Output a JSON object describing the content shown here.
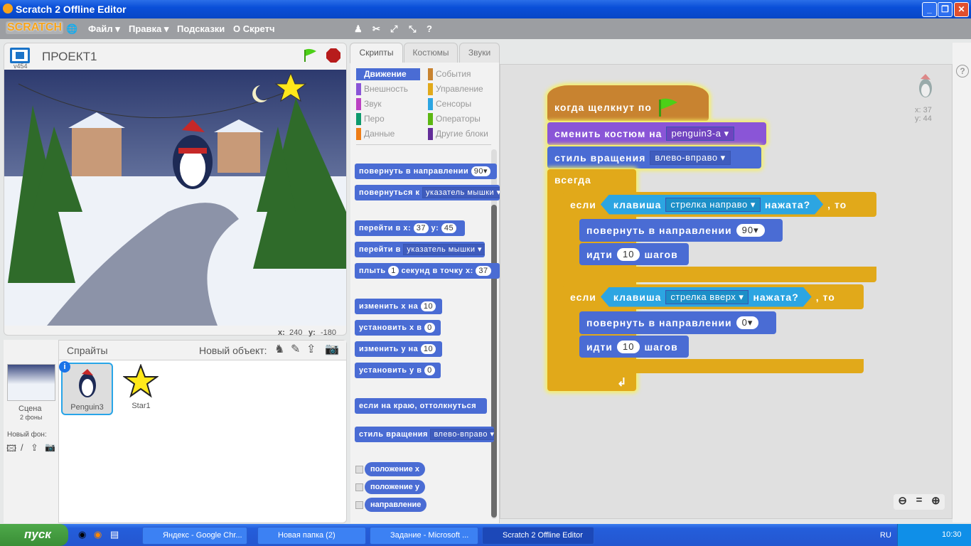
{
  "window": {
    "title": "Scratch 2 Offline Editor"
  },
  "menu": {
    "logo": "SCRATCH",
    "items": [
      "Файл ▾",
      "Правка ▾",
      "Подсказки",
      "О Скретч"
    ]
  },
  "stage": {
    "project_name": "ПРОЕКТ1",
    "version": "v454",
    "x_label": "x:",
    "x_value": "240",
    "y_label": "y:",
    "y_value": "-180"
  },
  "sprites": {
    "header": "Спрайты",
    "new_object": "Новый объект:",
    "stage_label": "Сцена",
    "backdrops": "2 фоны",
    "new_backdrop": "Новый фон:",
    "list": [
      {
        "name": "Penguin3",
        "selected": true
      },
      {
        "name": "Star1",
        "selected": false
      }
    ]
  },
  "tabs": [
    "Скрипты",
    "Костюмы",
    "Звуки"
  ],
  "categories": [
    {
      "label": "Движение",
      "color": "#4a6cd4",
      "active": true
    },
    {
      "label": "События",
      "color": "#c88330"
    },
    {
      "label": "Внешность",
      "color": "#8a55d7"
    },
    {
      "label": "Управление",
      "color": "#e1a91a"
    },
    {
      "label": "Звук",
      "color": "#bb42c3"
    },
    {
      "label": "Сенсоры",
      "color": "#2ca5e2"
    },
    {
      "label": "Перо",
      "color": "#0e9a6c"
    },
    {
      "label": "Операторы",
      "color": "#5cb712"
    },
    {
      "label": "Данные",
      "color": "#ee7d16"
    },
    {
      "label": "Другие блоки",
      "color": "#632d99"
    }
  ],
  "palette": {
    "turn_dir": "повернуть в направлении",
    "turn_dir_val": "90▾",
    "point_to": "повернуться к",
    "point_to_val": "указатель мышки ▾",
    "goto_xy": "перейти в x:",
    "goto_x": "37",
    "y_lbl": "y:",
    "goto_y": "45",
    "goto": "перейти в",
    "goto_val": "указатель мышки ▾",
    "glide": "плыть",
    "glide_val": "1",
    "glide_rest": "секунд в точку x:",
    "glide_x": "37",
    "change_x": "изменить х на",
    "change_x_val": "10",
    "set_x": "установить х в",
    "set_x_val": "0",
    "change_y": "изменить у на",
    "change_y_val": "10",
    "set_y": "установить у в",
    "set_y_val": "0",
    "bounce": "если на краю, оттолкнуться",
    "rot_style": "стиль вращения",
    "rot_style_val": "влево-вправо ▾",
    "reporters": [
      "положение x",
      "положение y",
      "направление"
    ]
  },
  "script": {
    "hat": "когда щелкнут по",
    "costume": "сменить костюм на",
    "costume_val": "penguin3-a ▾",
    "rot": "стиль вращения",
    "rot_val": "влево-вправо ▾",
    "forever": "всегда",
    "if": "если",
    "then": ", то",
    "key": "клавиша",
    "pressed": "нажата?",
    "key1": "стрелка направо ▾",
    "key2": "стрелка вверх ▾",
    "turn": "повернуть в направлении",
    "turn1": "90▾",
    "turn2": "0▾",
    "move": "идти",
    "steps": "10",
    "steps_lbl": "шагов"
  },
  "sprite_info": {
    "x": "x: 37",
    "y": "y: 44"
  },
  "taskbar": {
    "start": "пуск",
    "tasks": [
      "Яндекс - Google Chr...",
      "Новая папка (2)",
      "Задание - Microsoft ...",
      "Scratch 2 Offline Editor"
    ],
    "lang": "RU",
    "time": "10:30"
  }
}
